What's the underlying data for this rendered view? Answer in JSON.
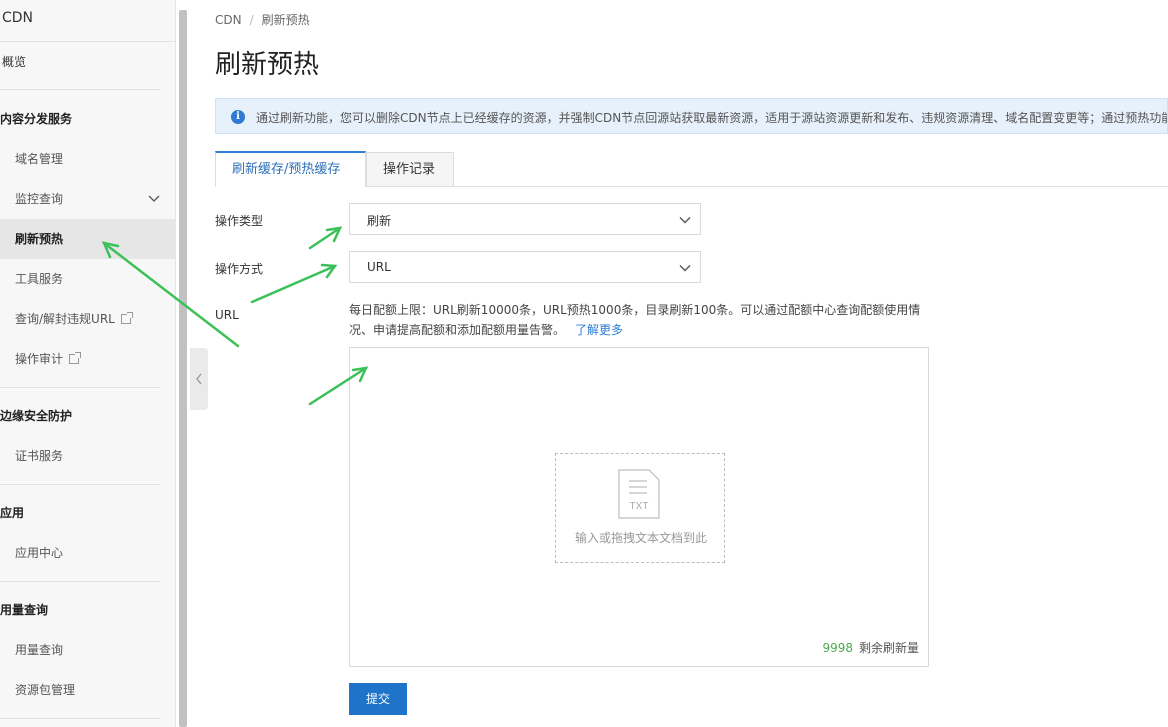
{
  "sidebar": {
    "title": "CDN",
    "overview": "概览",
    "groups": {
      "content": "内容分发服务",
      "edge": "边缘安全防护",
      "apps": "应用",
      "usage": "用量查询"
    },
    "items": {
      "domain": "域名管理",
      "monitor": "监控查询",
      "refresh": "刷新预热",
      "tools": "工具服务",
      "violation": "查询/解封违规URL",
      "audit": "操作审计",
      "cert": "证书服务",
      "app_center": "应用中心",
      "usage_query": "用量查询",
      "package": "资源包管理"
    }
  },
  "breadcrumb": {
    "root": "CDN",
    "sep": "/",
    "current": "刷新预热"
  },
  "page_title": "刷新预热",
  "notice": {
    "icon": "info-icon",
    "text": "通过刷新功能，您可以删除CDN节点上已经缓存的资源，并强制CDN节点回源站获取最新资源，适用于源站资源更新和发布、违规资源清理、域名配置变更等；通过预热功能"
  },
  "tabs": [
    {
      "label": "刷新缓存/预热缓存",
      "active": true
    },
    {
      "label": "操作记录",
      "active": false
    }
  ],
  "form": {
    "operation_type_label": "操作类型",
    "operation_type_value": "刷新",
    "operation_mode_label": "操作方式",
    "operation_mode_value": "URL",
    "url_label": "URL",
    "quota_text": "每日配额上限：URL刷新10000条，URL预热1000条，目录刷新100条。可以通过配额中心查询配额使用情况、申请提高配额和添加配额用量告警。",
    "quota_link": "了解更多",
    "dropzone_icon_text": "TXT",
    "dropzone_text": "输入或拖拽文本文档到此",
    "remaining_count": "9998",
    "remaining_label": "剩余刷新量",
    "submit_label": "提交"
  },
  "colors": {
    "accent": "#1f73c9",
    "notice_bg": "#e7f1fb",
    "counter_green": "#4caa4f",
    "annotation_arrow": "#3cc05a"
  }
}
